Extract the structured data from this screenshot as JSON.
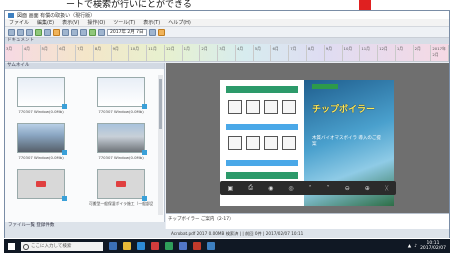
{
  "caption": "ートで検索が行いにとができる",
  "window": {
    "title": "図面 画面 有償の取扱い（現行版）",
    "menu": [
      "ファイル",
      "編集(E)",
      "表示(V)",
      "操作(O)",
      "ツール(T)",
      "表示(T)",
      "ヘルプ(H)"
    ],
    "date_field": "2017年 2月 7日"
  },
  "datestrip": {
    "label": "ドキュメント",
    "cells": [
      "3月",
      "4月",
      "5月",
      "6月",
      "7月",
      "8月",
      "9月",
      "10月",
      "11月",
      "12月",
      "1月",
      "2月",
      "3月",
      "4月",
      "5月",
      "6月",
      "7月",
      "8月",
      "9月",
      "10月",
      "11月",
      "12月",
      "1月",
      "2月",
      "2017年 2月"
    ]
  },
  "left_pane": {
    "header": "サムネイル",
    "thumbs": [
      {
        "label": "770307 Window(0.0Mb)",
        "kind": "doc"
      },
      {
        "label": "770307 Window(0.0Mb)",
        "kind": "doc"
      },
      {
        "label": "770307 Window(0.0Mb)",
        "kind": "photo1"
      },
      {
        "label": "770307 Window(0.0Mb)",
        "kind": "photo2"
      },
      {
        "label": "",
        "kind": "redicon"
      },
      {
        "label": "可搬型一般保湿ボイラ施工（一般部品等）",
        "kind": "redicon"
      }
    ],
    "footer": "ファイル一覧  登録件数"
  },
  "right_pane": {
    "brochure_heading": "チップボイラー",
    "brochure_sub": "木質バイオマスボイラ 導入のご提案",
    "memo": "チップボイラー ご案内（2-17）"
  },
  "statusbar": "Acrobat.pdf 2017 0.00MB 検索済 | | 前回 0件 | 2017/02/07 10:11",
  "taskbar": {
    "search_placeholder": "ここに入力して検索",
    "time": "10:11",
    "date": "2017/02/07"
  },
  "colors": {
    "arrow": "#e02020",
    "title_blue": "#3d7fc0",
    "taskbar": "#101824"
  }
}
